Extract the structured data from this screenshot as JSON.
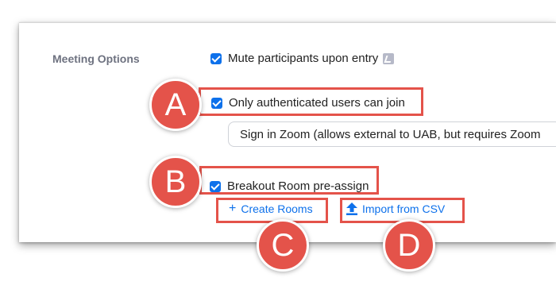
{
  "section": {
    "label": "Meeting Options"
  },
  "options": {
    "mute": {
      "label": "Mute participants upon entry",
      "checked": true
    },
    "auth": {
      "label": "Only authenticated users can join",
      "checked": true
    },
    "auth_select": {
      "value": "Sign in Zoom (allows external to UAB, but requires Zoom"
    },
    "breakout": {
      "label": "Breakout Room pre-assign",
      "checked": true
    }
  },
  "links": {
    "create_rooms": "Create Rooms",
    "import_csv": "Import from CSV"
  },
  "callouts": {
    "a": "A",
    "b": "B",
    "c": "C",
    "d": "D"
  },
  "colors": {
    "accent": "#0e71eb",
    "callout": "#e4534a"
  }
}
